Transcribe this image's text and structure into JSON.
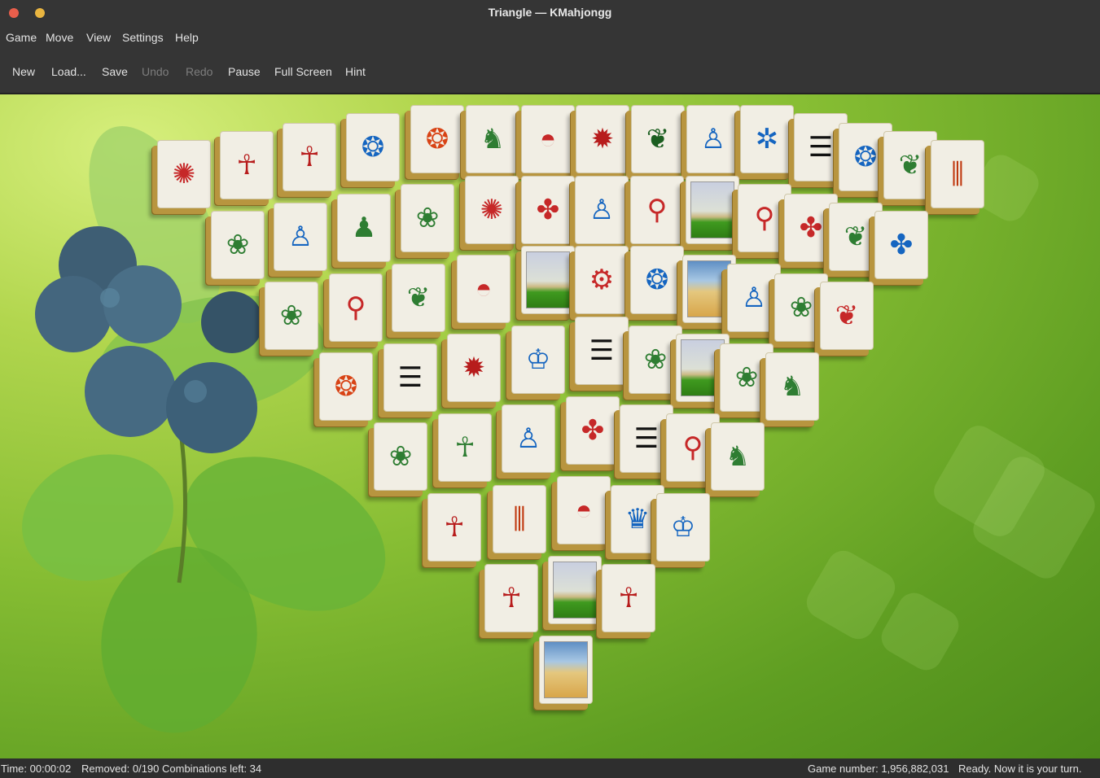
{
  "window": {
    "title": "Triangle — KMahjongg"
  },
  "menu": [
    "Game",
    "Move",
    "View",
    "Settings",
    "Help"
  ],
  "toolbar": [
    {
      "label": "New",
      "enabled": true
    },
    {
      "label": "Load...",
      "enabled": true
    },
    {
      "label": "Save",
      "enabled": true
    },
    {
      "label": "Undo",
      "enabled": false
    },
    {
      "label": "Redo",
      "enabled": false
    },
    {
      "label": "Pause",
      "enabled": true
    },
    {
      "label": "Full Screen",
      "enabled": true
    },
    {
      "label": "Hint",
      "enabled": true
    }
  ],
  "board": {
    "layout_name": "Triangle",
    "background": "blueberry-leaves",
    "colors": {
      "bg_light": "#d7ef7d",
      "bg_dark": "#4c8a1a",
      "tile_face": "#f1eee4",
      "tile_edge": "#b8953f"
    },
    "tiles": [
      {
        "symbol": "wheel-compass",
        "icon": "✺",
        "color": "#c62828"
      },
      {
        "symbol": "goddess-red",
        "icon": "☥",
        "color": "#b71c1c"
      },
      {
        "symbol": "goddess-red",
        "icon": "☥",
        "color": "#b71c1c"
      },
      {
        "symbol": "wheel-four",
        "icon": "❂",
        "color": "#1565c0"
      },
      {
        "symbol": "sun-shield",
        "icon": "❂",
        "color": "#d84315"
      },
      {
        "symbol": "anubis-kneeling",
        "icon": "♞",
        "color": "#2e7d32"
      },
      {
        "symbol": "fan-rising-sun",
        "icon": "◓",
        "color": "#c62828"
      },
      {
        "symbol": "wheel-dots",
        "icon": "✹",
        "color": "#b71c1c"
      },
      {
        "symbol": "feather",
        "icon": "❦",
        "color": "#1b5e20"
      },
      {
        "symbol": "man-staff",
        "icon": "♙",
        "color": "#1565c0"
      },
      {
        "symbol": "scarab",
        "icon": "✲",
        "color": "#1565c0"
      },
      {
        "symbol": "cartouche",
        "icon": "☰",
        "color": "#111111"
      },
      {
        "symbol": "wheel-four",
        "icon": "❂",
        "color": "#1565c0"
      },
      {
        "symbol": "papyrus",
        "icon": "❦",
        "color": "#2e7d32"
      },
      {
        "symbol": "pillars",
        "icon": "⫼",
        "color": "#bf360c"
      },
      {
        "symbol": "lotus",
        "icon": "❀",
        "color": "#2e7d32"
      },
      {
        "symbol": "man-figure",
        "icon": "♙",
        "color": "#1565c0"
      },
      {
        "symbol": "falcon",
        "icon": "♟",
        "color": "#2e7d32"
      },
      {
        "symbol": "lotus",
        "icon": "❀",
        "color": "#2e7d32"
      },
      {
        "symbol": "wheel-compass",
        "icon": "✺",
        "color": "#c62828"
      },
      {
        "symbol": "triad-red",
        "icon": "✤",
        "color": "#c62828"
      },
      {
        "symbol": "man-staff-blue",
        "icon": "♙",
        "color": "#1565c0"
      },
      {
        "symbol": "staff-wheel",
        "icon": "⚲",
        "color": "#c62828"
      },
      {
        "symbol": "landscape-pyramids",
        "icon": "",
        "color": "#2e7d32"
      },
      {
        "symbol": "staff-wheel",
        "icon": "⚲",
        "color": "#c62828"
      },
      {
        "symbol": "triad-red",
        "icon": "✤",
        "color": "#c62828"
      },
      {
        "symbol": "papyrus",
        "icon": "❦",
        "color": "#2e7d32"
      },
      {
        "symbol": "triad-blue",
        "icon": "✤",
        "color": "#1565c0"
      },
      {
        "symbol": "lotus",
        "icon": "❀",
        "color": "#2e7d32"
      },
      {
        "symbol": "staff-wheel",
        "icon": "⚲",
        "color": "#c62828"
      },
      {
        "symbol": "papyrus",
        "icon": "❦",
        "color": "#2e7d32"
      },
      {
        "symbol": "fan-rising-sun",
        "icon": "◓",
        "color": "#c62828"
      },
      {
        "symbol": "landscape-pyramids",
        "icon": "",
        "color": "#2e7d32"
      },
      {
        "symbol": "double-wheel",
        "icon": "⚙",
        "color": "#c62828"
      },
      {
        "symbol": "wheel-four",
        "icon": "❂",
        "color": "#1565c0"
      },
      {
        "symbol": "desert-pyramids",
        "icon": "",
        "color": "#d8a64a"
      },
      {
        "symbol": "man-figure",
        "icon": "♙",
        "color": "#1565c0"
      },
      {
        "symbol": "lotus",
        "icon": "❀",
        "color": "#2e7d32"
      },
      {
        "symbol": "papyrus",
        "icon": "❦",
        "color": "#c62828"
      },
      {
        "symbol": "sun-shield",
        "icon": "❂",
        "color": "#d84315"
      },
      {
        "symbol": "cartouche",
        "icon": "☰",
        "color": "#111111"
      },
      {
        "symbol": "wheel-dots",
        "icon": "✹",
        "color": "#b71c1c"
      },
      {
        "symbol": "man-seated",
        "icon": "♔",
        "color": "#1565c0"
      },
      {
        "symbol": "cartouche",
        "icon": "☰",
        "color": "#111111"
      },
      {
        "symbol": "lotus",
        "icon": "❀",
        "color": "#2e7d32"
      },
      {
        "symbol": "landscape-pyramids",
        "icon": "",
        "color": "#2e7d32"
      },
      {
        "symbol": "lotus",
        "icon": "❀",
        "color": "#2e7d32"
      },
      {
        "symbol": "anubis-kneeling",
        "icon": "♞",
        "color": "#2e7d32"
      },
      {
        "symbol": "lotus",
        "icon": "❀",
        "color": "#2e7d32"
      },
      {
        "symbol": "goddess-green",
        "icon": "☥",
        "color": "#2e7d32"
      },
      {
        "symbol": "man-figure",
        "icon": "♙",
        "color": "#1565c0"
      },
      {
        "symbol": "triad-red",
        "icon": "✤",
        "color": "#c62828"
      },
      {
        "symbol": "cartouche",
        "icon": "☰",
        "color": "#111111"
      },
      {
        "symbol": "staff-wheel",
        "icon": "⚲",
        "color": "#c62828"
      },
      {
        "symbol": "anubis-kneeling",
        "icon": "♞",
        "color": "#2e7d32"
      },
      {
        "symbol": "goddess-red",
        "icon": "☥",
        "color": "#b71c1c"
      },
      {
        "symbol": "pillars",
        "icon": "⫼",
        "color": "#bf360c"
      },
      {
        "symbol": "fan-rising-sun",
        "icon": "◓",
        "color": "#c62828"
      },
      {
        "symbol": "crown-blue",
        "icon": "♛",
        "color": "#1565c0"
      },
      {
        "symbol": "man-seated",
        "icon": "♔",
        "color": "#1565c0"
      },
      {
        "symbol": "goddess-red",
        "icon": "☥",
        "color": "#b71c1c"
      },
      {
        "symbol": "landscape-pyramids",
        "icon": "",
        "color": "#2e7d32"
      },
      {
        "symbol": "goddess-red",
        "icon": "☥",
        "color": "#b71c1c"
      },
      {
        "symbol": "desert-pyramids",
        "icon": "",
        "color": "#d8a64a"
      }
    ]
  },
  "status": {
    "time": "Time: 00:00:02",
    "removed": "Removed: 0/190",
    "combinations": "Combinations left: 34",
    "game_number": "Game number: 1,956,882,031",
    "message": "Ready. Now it is your turn."
  }
}
